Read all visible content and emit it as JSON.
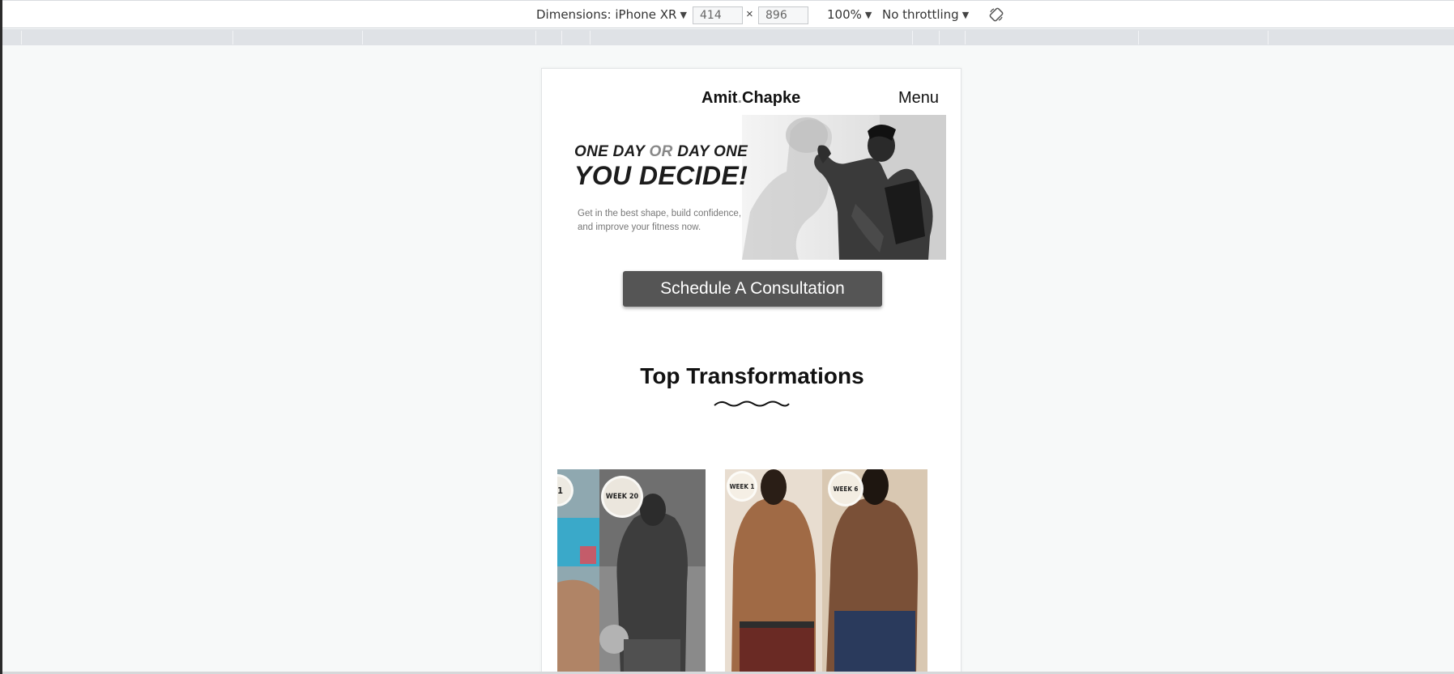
{
  "devtools": {
    "dimensions_label": "Dimensions: iPhone XR",
    "width_value": "414",
    "height_value": "896",
    "times": "×",
    "zoom": "100%",
    "throttling": "No throttling",
    "caret": "▼"
  },
  "site": {
    "brand_first": "Amit",
    "brand_dot": ".",
    "brand_last": "Chapke",
    "menu_label": "Menu"
  },
  "hero": {
    "line1_a": "ONE DAY ",
    "line1_or": "OR",
    "line1_b": " DAY ONE",
    "line2": "YOU DECIDE!",
    "subtext_1": "Get in the best shape, build confidence,",
    "subtext_2": "and improve your fitness now."
  },
  "cta": {
    "label": "Schedule A Consultation"
  },
  "transformations": {
    "title": "Top Transformations",
    "cards": [
      {
        "badge_left": "1",
        "badge_right": "WEEK 20"
      },
      {
        "badge_left": "WEEK 1",
        "badge_right": "WEEK 6"
      }
    ]
  }
}
